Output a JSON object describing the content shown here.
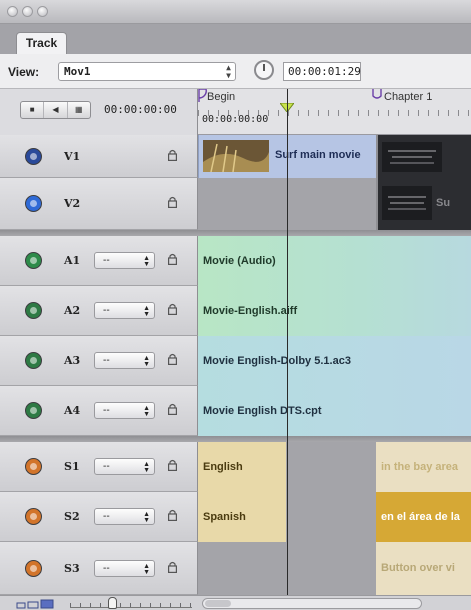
{
  "tab": {
    "label": "Track"
  },
  "viewbar": {
    "label": "View:",
    "selected": "Mov1",
    "duration": "00:00:01:29"
  },
  "controls": {
    "timecode": "00:00:00:00"
  },
  "ruler": {
    "start_timecode": "00:00:00:00",
    "markers": [
      {
        "name": "Begin"
      },
      {
        "name": "Chapter 1"
      }
    ]
  },
  "stream_placeholder": "--",
  "tracks": [
    {
      "id": "V1",
      "color": "#2a4a9a",
      "clips": [
        {
          "label": "Surf main movie"
        },
        {
          "label": ""
        }
      ]
    },
    {
      "id": "V2",
      "color": "#2f6ad6",
      "clips": [
        {
          "label": ""
        },
        {
          "label": "Su"
        }
      ]
    },
    {
      "id": "A1",
      "color": "#2e8b4a",
      "clips": [
        {
          "label": "Movie (Audio)"
        }
      ]
    },
    {
      "id": "A2",
      "color": "#2e7a44",
      "clips": [
        {
          "label": "Movie-English.aiff"
        }
      ]
    },
    {
      "id": "A3",
      "color": "#2e7a44",
      "clips": [
        {
          "label": "Movie English-Dolby 5.1.ac3"
        }
      ]
    },
    {
      "id": "A4",
      "color": "#2e7a44",
      "clips": [
        {
          "label": "Movie English DTS.cpt"
        }
      ]
    },
    {
      "id": "S1",
      "color": "#d2742a",
      "clips": [
        {
          "label": "English"
        },
        {
          "label": "in the bay area"
        }
      ]
    },
    {
      "id": "S2",
      "color": "#d2742a",
      "clips": [
        {
          "label": "Spanish"
        },
        {
          "label": "en el área de la"
        }
      ]
    },
    {
      "id": "S3",
      "color": "#d2742a",
      "clips": [
        {
          "label": ""
        },
        {
          "label": "Button over vi"
        }
      ]
    }
  ]
}
